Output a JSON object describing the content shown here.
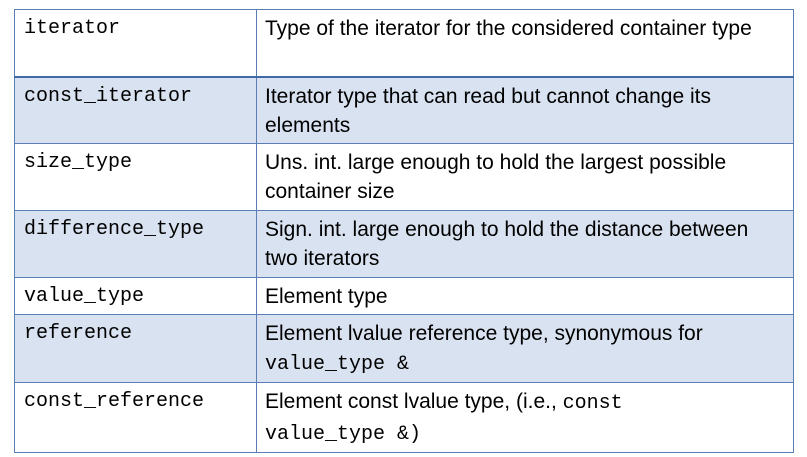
{
  "table": {
    "rows": [
      {
        "name": "iterator",
        "description": "Type of the iterator for the considered container type"
      },
      {
        "name": "const_iterator",
        "description": "Iterator type that can read but cannot change its elements"
      },
      {
        "name": "size_type",
        "description": "Uns. int. large enough to hold the largest possible container size"
      },
      {
        "name": "difference_type",
        "description": "Sign. int. large enough to hold the distance between two iterators"
      },
      {
        "name": "value_type",
        "description": "Element type"
      },
      {
        "name": "reference",
        "description": "Element lvalue reference type, synonymous for",
        "description_code": "value_type &"
      },
      {
        "name": "const_reference",
        "description": "Element const lvalue type, (i.e.,",
        "description_code_inline": "const",
        "description_code": "value_type &)"
      }
    ]
  }
}
